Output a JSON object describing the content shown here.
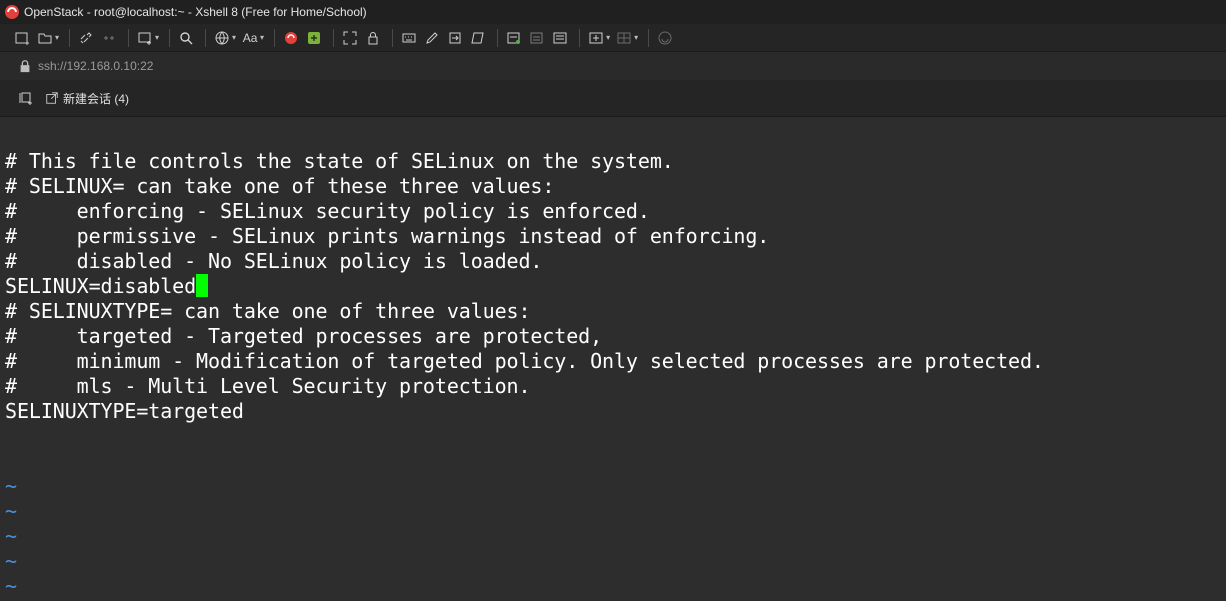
{
  "window": {
    "title": "OpenStack - root@localhost:~ - Xshell 8 (Free for Home/School)"
  },
  "toolbar": {
    "font_label": "Aa",
    "icons": [
      "new-session-icon",
      "open-folder-icon",
      "connect-icon",
      "disconnect-icon",
      "new-window-icon",
      "search-icon",
      "globe-icon",
      "font-icon",
      "xshell-logo-icon",
      "xftp-icon",
      "fullscreen-icon",
      "lock-icon",
      "keyboard-icon",
      "highlight-icon",
      "transfer-icon",
      "script-icon",
      "compose-icon",
      "log-icon",
      "tab-icon",
      "layout-icon",
      "help-icon"
    ]
  },
  "address": {
    "url": "ssh://192.168.0.10:22"
  },
  "tabs": {
    "new_session_label": "新建会话 (4)"
  },
  "terminal": {
    "lines": [
      "# This file controls the state of SELinux on the system.",
      "# SELINUX= can take one of these three values:",
      "#     enforcing - SELinux security policy is enforced.",
      "#     permissive - SELinux prints warnings instead of enforcing.",
      "#     disabled - No SELinux policy is loaded.",
      "SELINUX=disabled",
      "# SELINUXTYPE= can take one of three values:",
      "#     targeted - Targeted processes are protected,",
      "#     minimum - Modification of targeted policy. Only selected processes are protected.",
      "#     mls - Multi Level Security protection.",
      "SELINUXTYPE=targeted"
    ],
    "tilde": "~",
    "colors": {
      "cursor": "#00ff00",
      "tilde": "#4a90d9",
      "background": "#2d2d2d"
    }
  }
}
